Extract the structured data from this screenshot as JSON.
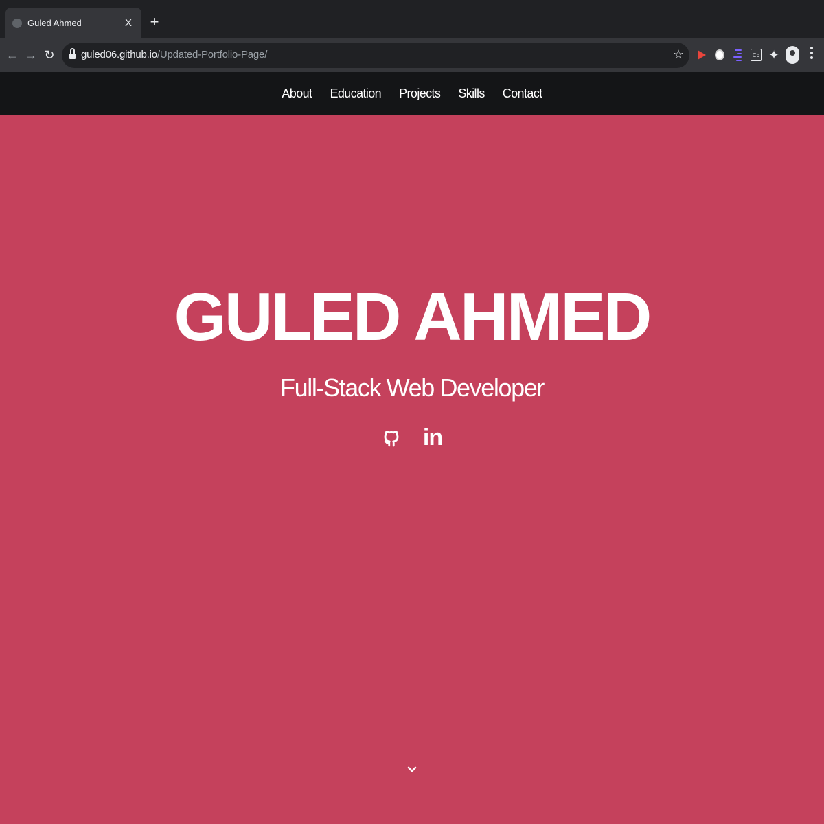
{
  "browser": {
    "tab_title": "Guled Ahmed",
    "tab_close": "X",
    "new_tab": "+",
    "url_host": "guled06.github.io",
    "url_path": "/Updated-Portfolio-Page/",
    "ext_cb_label": "Cb"
  },
  "navbar": {
    "items": [
      {
        "label": "About"
      },
      {
        "label": "Education"
      },
      {
        "label": "Projects"
      },
      {
        "label": "Skills"
      },
      {
        "label": "Contact"
      }
    ]
  },
  "hero": {
    "name": "GULED AHMED",
    "role": "Full-Stack Web Developer",
    "socials": [
      {
        "icon": "github-icon"
      },
      {
        "icon": "linkedin-icon",
        "label": "in"
      }
    ],
    "scroll_icon": "chevron-down-icon"
  },
  "colors": {
    "hero_background": "#c5415c",
    "navbar_background": "#141517",
    "text": "#ffffff"
  }
}
